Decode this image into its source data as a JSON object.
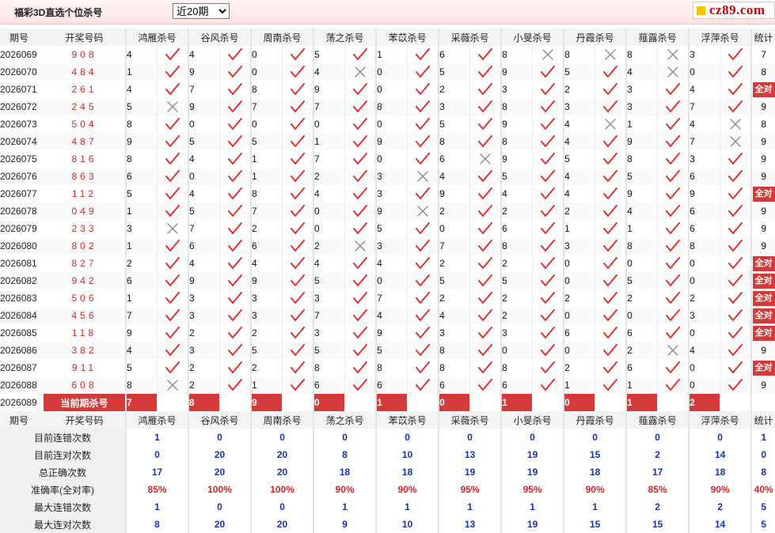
{
  "header": {
    "title": "福彩3D直选个位杀号",
    "period_select": {
      "value": "近20期",
      "options": [
        "近20期"
      ]
    },
    "logo_text": "cz89.com"
  },
  "columns": {
    "period": "期号",
    "draw": "开奖号码",
    "experts": [
      "鸿雁杀号",
      "谷风杀号",
      "周南杀号",
      "荡之杀号",
      "苯苡杀号",
      "采薇杀号",
      "小旻杀号",
      "丹霞杀号",
      "薤露杀号",
      "浮萍杀号"
    ],
    "count": "统计"
  },
  "rows": [
    {
      "period": "2026069",
      "draw": "908",
      "picks": [
        [
          4,
          1
        ],
        [
          4,
          1
        ],
        [
          0,
          1
        ],
        [
          5,
          1
        ],
        [
          1,
          1
        ],
        [
          6,
          1
        ],
        [
          8,
          0
        ],
        [
          8,
          0
        ],
        [
          8,
          0
        ],
        [
          3,
          1
        ]
      ],
      "count": "7"
    },
    {
      "period": "2026070",
      "draw": "484",
      "picks": [
        [
          1,
          1
        ],
        [
          9,
          1
        ],
        [
          0,
          1
        ],
        [
          4,
          0
        ],
        [
          0,
          1
        ],
        [
          5,
          1
        ],
        [
          9,
          1
        ],
        [
          5,
          1
        ],
        [
          4,
          0
        ],
        [
          0,
          1
        ]
      ],
      "count": "8"
    },
    {
      "period": "2026071",
      "draw": "261",
      "picks": [
        [
          4,
          1
        ],
        [
          7,
          1
        ],
        [
          8,
          1
        ],
        [
          9,
          1
        ],
        [
          0,
          1
        ],
        [
          2,
          1
        ],
        [
          3,
          1
        ],
        [
          2,
          1
        ],
        [
          3,
          1
        ],
        [
          4,
          1
        ]
      ],
      "count": "全对"
    },
    {
      "period": "2026072",
      "draw": "245",
      "picks": [
        [
          5,
          0
        ],
        [
          9,
          1
        ],
        [
          7,
          1
        ],
        [
          7,
          1
        ],
        [
          8,
          1
        ],
        [
          3,
          1
        ],
        [
          8,
          1
        ],
        [
          3,
          1
        ],
        [
          3,
          1
        ],
        [
          7,
          1
        ]
      ],
      "count": "9"
    },
    {
      "period": "2026073",
      "draw": "504",
      "picks": [
        [
          8,
          1
        ],
        [
          0,
          1
        ],
        [
          0,
          1
        ],
        [
          0,
          1
        ],
        [
          0,
          1
        ],
        [
          5,
          1
        ],
        [
          9,
          1
        ],
        [
          4,
          0
        ],
        [
          1,
          1
        ],
        [
          4,
          0
        ]
      ],
      "count": "8"
    },
    {
      "period": "2026074",
      "draw": "487",
      "picks": [
        [
          9,
          1
        ],
        [
          5,
          1
        ],
        [
          5,
          1
        ],
        [
          1,
          1
        ],
        [
          9,
          1
        ],
        [
          8,
          1
        ],
        [
          8,
          1
        ],
        [
          4,
          1
        ],
        [
          9,
          1
        ],
        [
          7,
          0
        ]
      ],
      "count": "9"
    },
    {
      "period": "2026075",
      "draw": "816",
      "picks": [
        [
          8,
          1
        ],
        [
          4,
          1
        ],
        [
          1,
          1
        ],
        [
          7,
          1
        ],
        [
          0,
          1
        ],
        [
          6,
          0
        ],
        [
          9,
          1
        ],
        [
          5,
          1
        ],
        [
          8,
          1
        ],
        [
          3,
          1
        ]
      ],
      "count": "9"
    },
    {
      "period": "2026076",
      "draw": "863",
      "picks": [
        [
          6,
          1
        ],
        [
          0,
          1
        ],
        [
          1,
          1
        ],
        [
          2,
          1
        ],
        [
          3,
          0
        ],
        [
          4,
          1
        ],
        [
          5,
          1
        ],
        [
          4,
          1
        ],
        [
          5,
          1
        ],
        [
          6,
          1
        ]
      ],
      "count": "9"
    },
    {
      "period": "2026077",
      "draw": "112",
      "picks": [
        [
          5,
          1
        ],
        [
          4,
          1
        ],
        [
          8,
          1
        ],
        [
          4,
          1
        ],
        [
          3,
          1
        ],
        [
          9,
          1
        ],
        [
          4,
          1
        ],
        [
          4,
          1
        ],
        [
          9,
          1
        ],
        [
          9,
          1
        ]
      ],
      "count": "全对"
    },
    {
      "period": "2026078",
      "draw": "049",
      "picks": [
        [
          1,
          1
        ],
        [
          5,
          1
        ],
        [
          7,
          1
        ],
        [
          0,
          1
        ],
        [
          9,
          0
        ],
        [
          2,
          1
        ],
        [
          2,
          1
        ],
        [
          2,
          1
        ],
        [
          4,
          1
        ],
        [
          6,
          1
        ]
      ],
      "count": "9"
    },
    {
      "period": "2026079",
      "draw": "233",
      "picks": [
        [
          3,
          0
        ],
        [
          7,
          1
        ],
        [
          2,
          1
        ],
        [
          0,
          1
        ],
        [
          5,
          1
        ],
        [
          0,
          1
        ],
        [
          6,
          1
        ],
        [
          1,
          1
        ],
        [
          1,
          1
        ],
        [
          6,
          1
        ]
      ],
      "count": "9"
    },
    {
      "period": "2026080",
      "draw": "802",
      "picks": [
        [
          1,
          1
        ],
        [
          6,
          1
        ],
        [
          6,
          1
        ],
        [
          2,
          0
        ],
        [
          3,
          1
        ],
        [
          7,
          1
        ],
        [
          8,
          1
        ],
        [
          3,
          1
        ],
        [
          8,
          1
        ],
        [
          8,
          1
        ]
      ],
      "count": "9"
    },
    {
      "period": "2026081",
      "draw": "827",
      "picks": [
        [
          2,
          1
        ],
        [
          4,
          1
        ],
        [
          4,
          1
        ],
        [
          4,
          1
        ],
        [
          4,
          1
        ],
        [
          2,
          1
        ],
        [
          2,
          1
        ],
        [
          0,
          1
        ],
        [
          0,
          1
        ],
        [
          0,
          1
        ]
      ],
      "count": "全对"
    },
    {
      "period": "2026082",
      "draw": "942",
      "picks": [
        [
          6,
          1
        ],
        [
          9,
          1
        ],
        [
          9,
          1
        ],
        [
          5,
          1
        ],
        [
          0,
          1
        ],
        [
          5,
          1
        ],
        [
          5,
          1
        ],
        [
          0,
          1
        ],
        [
          5,
          1
        ],
        [
          0,
          1
        ]
      ],
      "count": "全对"
    },
    {
      "period": "2026083",
      "draw": "506",
      "picks": [
        [
          1,
          1
        ],
        [
          3,
          1
        ],
        [
          3,
          1
        ],
        [
          3,
          1
        ],
        [
          7,
          1
        ],
        [
          2,
          1
        ],
        [
          2,
          1
        ],
        [
          2,
          1
        ],
        [
          2,
          1
        ],
        [
          2,
          1
        ]
      ],
      "count": "全对"
    },
    {
      "period": "2026084",
      "draw": "456",
      "picks": [
        [
          7,
          1
        ],
        [
          3,
          1
        ],
        [
          3,
          1
        ],
        [
          7,
          1
        ],
        [
          4,
          1
        ],
        [
          4,
          1
        ],
        [
          2,
          1
        ],
        [
          0,
          1
        ],
        [
          0,
          1
        ],
        [
          3,
          1
        ]
      ],
      "count": "全对"
    },
    {
      "period": "2026085",
      "draw": "118",
      "picks": [
        [
          9,
          1
        ],
        [
          2,
          1
        ],
        [
          2,
          1
        ],
        [
          3,
          1
        ],
        [
          9,
          1
        ],
        [
          3,
          1
        ],
        [
          3,
          1
        ],
        [
          6,
          1
        ],
        [
          6,
          1
        ],
        [
          0,
          1
        ]
      ],
      "count": "全对"
    },
    {
      "period": "2026086",
      "draw": "382",
      "picks": [
        [
          4,
          1
        ],
        [
          3,
          1
        ],
        [
          5,
          1
        ],
        [
          5,
          1
        ],
        [
          5,
          1
        ],
        [
          8,
          1
        ],
        [
          0,
          1
        ],
        [
          0,
          1
        ],
        [
          2,
          0
        ],
        [
          4,
          1
        ]
      ],
      "count": "9"
    },
    {
      "period": "2026087",
      "draw": "911",
      "picks": [
        [
          5,
          1
        ],
        [
          2,
          1
        ],
        [
          2,
          1
        ],
        [
          8,
          1
        ],
        [
          8,
          1
        ],
        [
          8,
          1
        ],
        [
          8,
          1
        ],
        [
          2,
          1
        ],
        [
          6,
          1
        ],
        [
          0,
          1
        ]
      ],
      "count": "全对"
    },
    {
      "period": "2026088",
      "draw": "608",
      "picks": [
        [
          8,
          0
        ],
        [
          2,
          1
        ],
        [
          1,
          1
        ],
        [
          6,
          1
        ],
        [
          6,
          1
        ],
        [
          6,
          1
        ],
        [
          6,
          1
        ],
        [
          1,
          1
        ],
        [
          1,
          1
        ],
        [
          0,
          1
        ]
      ],
      "count": "9"
    }
  ],
  "current": {
    "period": "2026089",
    "label": "当前期杀号",
    "picks": [
      "7",
      "8",
      "9",
      "0",
      "1",
      "0",
      "1",
      "0",
      "1",
      "2"
    ]
  },
  "stats": [
    {
      "label": "目前连错次数",
      "values": [
        "1",
        "0",
        "0",
        "0",
        "0",
        "0",
        "0",
        "0",
        "0",
        "0",
        "1"
      ],
      "color": "blue"
    },
    {
      "label": "目前连对次数",
      "values": [
        "0",
        "20",
        "20",
        "8",
        "10",
        "13",
        "19",
        "15",
        "2",
        "14",
        "0"
      ],
      "color": "blue"
    },
    {
      "label": "总正确次数",
      "values": [
        "17",
        "20",
        "20",
        "18",
        "18",
        "19",
        "19",
        "18",
        "17",
        "18",
        "8"
      ],
      "color": "blue"
    },
    {
      "label": "准确率(全对率)",
      "values": [
        "85%",
        "100%",
        "100%",
        "90%",
        "90%",
        "95%",
        "95%",
        "90%",
        "85%",
        "90%",
        "40%"
      ],
      "color": "red"
    },
    {
      "label": "最大连错次数",
      "values": [
        "1",
        "0",
        "0",
        "1",
        "1",
        "1",
        "1",
        "1",
        "2",
        "2",
        "5"
      ],
      "color": "blue"
    },
    {
      "label": "最大连对次数",
      "values": [
        "8",
        "20",
        "20",
        "9",
        "10",
        "13",
        "19",
        "15",
        "15",
        "14",
        "5"
      ],
      "color": "blue"
    }
  ],
  "colors": {
    "accent": "#d53a3a",
    "check": "#e03030",
    "cross": "#888888",
    "stat_blue": "#1533b8",
    "stat_red": "#d42525"
  }
}
